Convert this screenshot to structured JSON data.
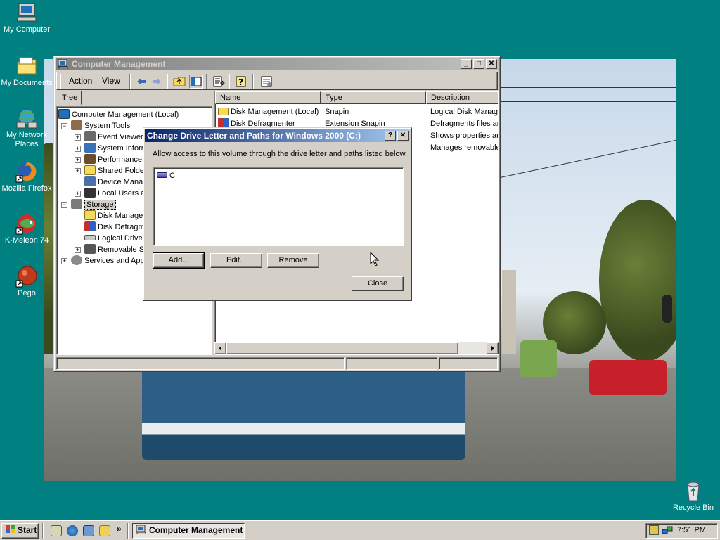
{
  "desktop": {
    "icons": [
      {
        "label": "My Computer",
        "icon": "computer-icon"
      },
      {
        "label": "My Documents",
        "icon": "folder-icon"
      },
      {
        "label": "My Network Places",
        "icon": "network-icon"
      },
      {
        "label": "Mozilla Firefox",
        "icon": "firefox-icon"
      },
      {
        "label": "K-Meleon 74",
        "icon": "kmeleon-icon"
      },
      {
        "label": "Pego",
        "icon": "pego-icon"
      },
      {
        "label": "Recycle Bin",
        "icon": "recycle-bin-icon"
      }
    ]
  },
  "computer_management": {
    "title": "Computer Management",
    "menu": [
      "Action",
      "View"
    ],
    "tree_tab": "Tree",
    "tree": [
      "Computer Management (Local)",
      "System Tools",
      "Event Viewer",
      "System Information",
      "Performance Logs and Alerts",
      "Shared Folders",
      "Device Manager",
      "Local Users and Groups",
      "Storage",
      "Disk Management",
      "Disk Defragmenter",
      "Logical Drives",
      "Removable Storage",
      "Services and Applications"
    ],
    "columns": [
      "Name",
      "Type",
      "Description"
    ],
    "rows": [
      {
        "name": "Disk Management (Local)",
        "type": "Snapin",
        "description": "Logical Disk Manager"
      },
      {
        "name": "Disk Defragmenter",
        "type": "Extension Snapin",
        "description": "Defragments files and"
      },
      {
        "name": "",
        "type": "",
        "description": "Shows properties and"
      },
      {
        "name": "",
        "type": "",
        "description": "Manages removable"
      }
    ]
  },
  "dialog": {
    "title": "Change Drive Letter and Paths for Windows 2000 (C:)",
    "help_label": "?",
    "close_x_label": "✕",
    "instruction": "Allow access to this volume through the drive letter and paths listed below.",
    "paths": [
      "C:"
    ],
    "add_label": "Add...",
    "edit_label": "Edit...",
    "remove_label": "Remove",
    "close_label": "Close"
  },
  "taskbar": {
    "start_label": "Start",
    "task_label": "Computer Management",
    "clock": "7:51 PM",
    "chevron": "»"
  }
}
